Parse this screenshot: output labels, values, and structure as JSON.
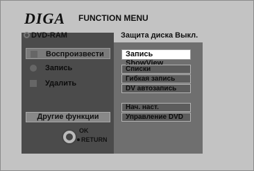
{
  "header": {
    "brand": "DIGA",
    "title": "FUNCTION MENU"
  },
  "media": {
    "label": "DVD-RAM",
    "icon": "disc-icon"
  },
  "protection": {
    "label": "Защита диска",
    "value": "Выкл."
  },
  "left_menu": {
    "items": [
      {
        "label": "Воспроизвести",
        "icon": "play-icon"
      },
      {
        "label": "Запись",
        "icon": "record-icon"
      },
      {
        "label": "Удалить",
        "icon": "trash-icon"
      }
    ],
    "other_functions": "Другие функции"
  },
  "navigation": {
    "ok": "OK",
    "return": "RETURN",
    "icon": "dpad-icon"
  },
  "right_menu": {
    "items": [
      "Запись ShowView",
      "Списки воспроизвед.",
      "Гибкая запись",
      "DV автозапись",
      "Нач. наст.",
      "Управление DVD"
    ]
  },
  "colors": {
    "background": "#c3c3c3",
    "left_panel": "#4b4b4b",
    "right_panel": "#6f6f6f",
    "selected": "#ffffff"
  }
}
